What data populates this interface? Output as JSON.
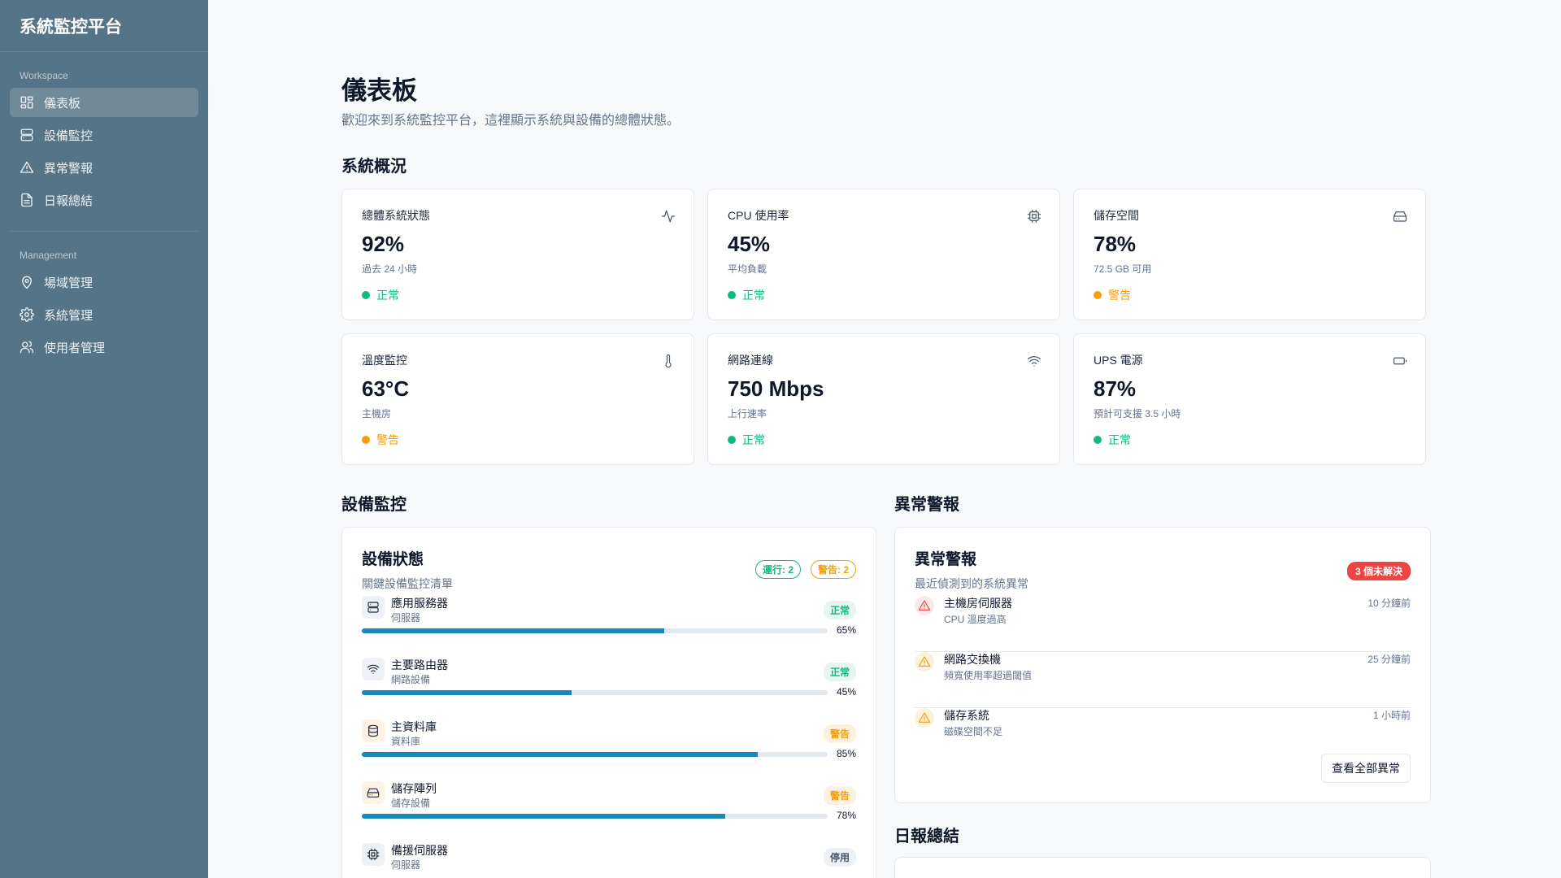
{
  "sidebar": {
    "brand": "系統監控平台",
    "sections": [
      {
        "heading": "Workspace",
        "items": [
          {
            "label": "儀表板",
            "icon": "dashboard-icon",
            "active": true
          },
          {
            "label": "設備監控",
            "icon": "server-icon"
          },
          {
            "label": "異常警報",
            "icon": "alert-triangle-icon"
          },
          {
            "label": "日報總結",
            "icon": "document-icon"
          }
        ]
      },
      {
        "heading": "Management",
        "items": [
          {
            "label": "場域管理",
            "icon": "map-pin-icon"
          },
          {
            "label": "系統管理",
            "icon": "gear-icon"
          },
          {
            "label": "使用者管理",
            "icon": "users-icon"
          }
        ]
      }
    ]
  },
  "header": {
    "title": "儀表板",
    "subtitle": "歡迎來到系統監控平台，這裡顯示系統與設備的總體狀態。"
  },
  "overview": {
    "title": "系統概況",
    "stats": [
      {
        "label": "總體系統狀態",
        "value": "92%",
        "sub": "過去 24 小時",
        "status": "正常",
        "level": "ok",
        "icon": "activity-icon"
      },
      {
        "label": "CPU 使用率",
        "value": "45%",
        "sub": "平均負載",
        "status": "正常",
        "level": "ok",
        "icon": "cpu-icon"
      },
      {
        "label": "儲存空間",
        "value": "78%",
        "sub": "72.5 GB 可用",
        "status": "警告",
        "level": "warn",
        "icon": "hard-drive-icon"
      },
      {
        "label": "溫度監控",
        "value": "63°C",
        "sub": "主機房",
        "status": "警告",
        "level": "warn",
        "icon": "thermometer-icon"
      },
      {
        "label": "網路連線",
        "value": "750 Mbps",
        "sub": "上行速率",
        "status": "正常",
        "level": "ok",
        "icon": "wifi-icon"
      },
      {
        "label": "UPS 電源",
        "value": "87%",
        "sub": "預計可支援 3.5 小時",
        "status": "正常",
        "level": "ok",
        "icon": "battery-icon"
      }
    ]
  },
  "equipment": {
    "section_title": "設備監控",
    "title": "設備狀態",
    "subtitle": "關鍵設備監控清單",
    "running_badge": "運行: 2",
    "warning_badge": "警告: 2",
    "devices": [
      {
        "name": "應用服務器",
        "type": "伺服器",
        "status": "正常",
        "level": "ok",
        "percent": 65,
        "percent_label": "65%",
        "icon": "server-icon"
      },
      {
        "name": "主要路由器",
        "type": "網路設備",
        "status": "正常",
        "level": "ok",
        "percent": 45,
        "percent_label": "45%",
        "icon": "wifi-icon"
      },
      {
        "name": "主資料庫",
        "type": "資料庫",
        "status": "警告",
        "level": "warn",
        "percent": 85,
        "percent_label": "85%",
        "icon": "database-icon"
      },
      {
        "name": "儲存陣列",
        "type": "儲存設備",
        "status": "警告",
        "level": "warn",
        "percent": 78,
        "percent_label": "78%",
        "icon": "hard-drive-icon"
      },
      {
        "name": "備援伺服器",
        "type": "伺服器",
        "status": "停用",
        "level": "off",
        "percent": 0,
        "percent_label": "",
        "icon": "cpu-icon"
      }
    ]
  },
  "alerts": {
    "section_title": "異常警報",
    "title": "異常警報",
    "subtitle": "最近偵測到的系統異常",
    "unresolved_badge": "3 個未解決",
    "items": [
      {
        "name": "主機房伺服器",
        "desc": "CPU 溫度過高",
        "time": "10 分鐘前",
        "severity": "critical"
      },
      {
        "name": "網路交換機",
        "desc": "頻寬使用率超過閾值",
        "time": "25 分鐘前",
        "severity": "warning"
      },
      {
        "name": "儲存系統",
        "desc": "磁碟空間不足",
        "time": "1 小時前",
        "severity": "warning"
      }
    ],
    "view_all_label": "查看全部異常"
  },
  "daily": {
    "section_title": "日報總結"
  },
  "colors": {
    "sidebar_bg": "#567487",
    "ok": "#10b981",
    "warning": "#f59e0b",
    "critical": "#ef4444",
    "progress": "#1689b8"
  }
}
